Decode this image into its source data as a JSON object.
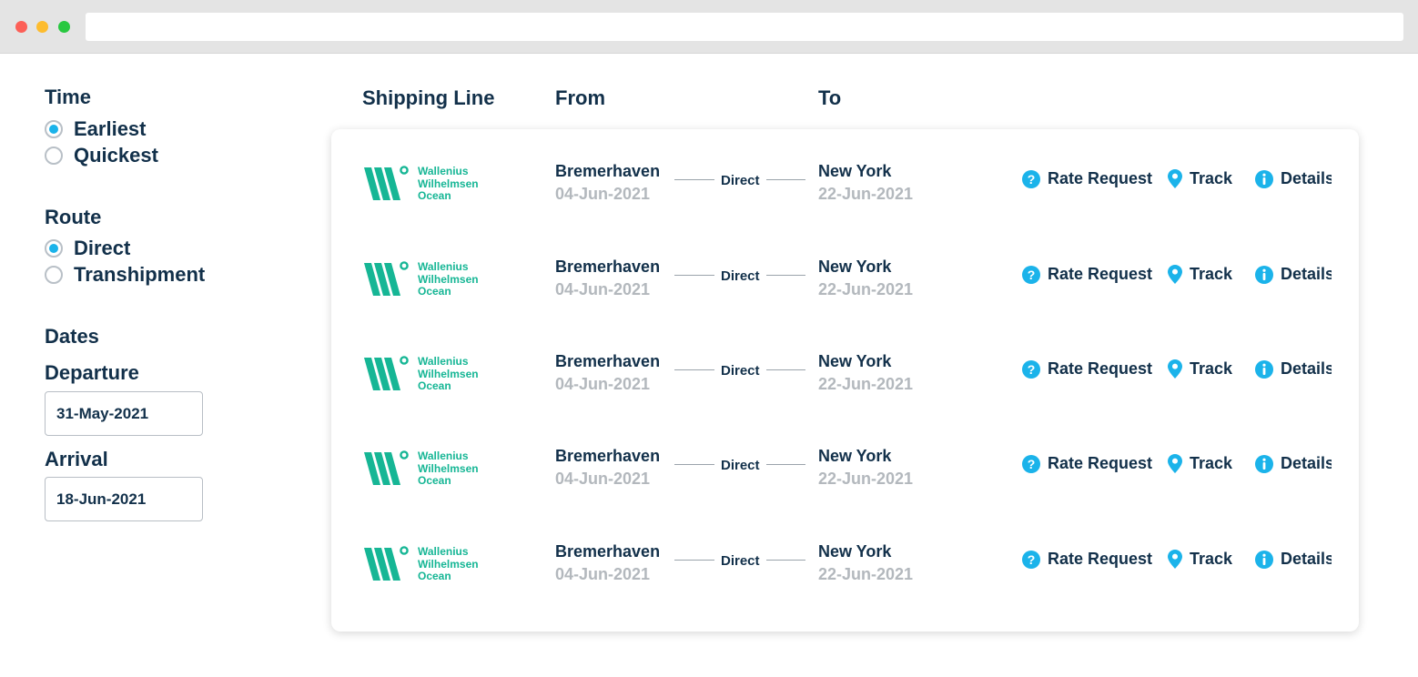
{
  "filters": {
    "time": {
      "title": "Time",
      "options": [
        {
          "label": "Earliest",
          "selected": true
        },
        {
          "label": "Quickest",
          "selected": false
        }
      ]
    },
    "route": {
      "title": "Route",
      "options": [
        {
          "label": "Direct",
          "selected": true
        },
        {
          "label": "Transhipment",
          "selected": false
        }
      ]
    },
    "dates": {
      "title": "Dates",
      "departure_label": "Departure",
      "departure_value": "31-May-2021",
      "arrival_label": "Arrival",
      "arrival_value": "18-Jun-2021"
    }
  },
  "table": {
    "headers": {
      "shipping_line": "Shipping Line",
      "from": "From",
      "to": "To"
    },
    "rows": [
      {
        "carrier": [
          "Wallenius",
          "Wilhelmsen",
          "Ocean"
        ],
        "from_city": "Bremerhaven",
        "from_date": "04-Jun-2021",
        "route": "Direct",
        "to_city": "New York",
        "to_date": "22-Jun-2021",
        "rate_label": "Rate Request",
        "track_label": "Track",
        "details_label": "Details"
      },
      {
        "carrier": [
          "Wallenius",
          "Wilhelmsen",
          "Ocean"
        ],
        "from_city": "Bremerhaven",
        "from_date": "04-Jun-2021",
        "route": "Direct",
        "to_city": "New York",
        "to_date": "22-Jun-2021",
        "rate_label": "Rate Request",
        "track_label": "Track",
        "details_label": "Details"
      },
      {
        "carrier": [
          "Wallenius",
          "Wilhelmsen",
          "Ocean"
        ],
        "from_city": "Bremerhaven",
        "from_date": "04-Jun-2021",
        "route": "Direct",
        "to_city": "New York",
        "to_date": "22-Jun-2021",
        "rate_label": "Rate Request",
        "track_label": "Track",
        "details_label": "Details"
      },
      {
        "carrier": [
          "Wallenius",
          "Wilhelmsen",
          "Ocean"
        ],
        "from_city": "Bremerhaven",
        "from_date": "04-Jun-2021",
        "route": "Direct",
        "to_city": "New York",
        "to_date": "22-Jun-2021",
        "rate_label": "Rate Request",
        "track_label": "Track",
        "details_label": "Details"
      },
      {
        "carrier": [
          "Wallenius",
          "Wilhelmsen",
          "Ocean"
        ],
        "from_city": "Bremerhaven",
        "from_date": "04-Jun-2021",
        "route": "Direct",
        "to_city": "New York",
        "to_date": "22-Jun-2021",
        "rate_label": "Rate Request",
        "track_label": "Track",
        "details_label": "Details"
      }
    ]
  },
  "icons": {
    "rate": "question-circle-icon",
    "track": "map-pin-icon",
    "details": "info-circle-icon"
  },
  "colors": {
    "accent": "#1bb3ea",
    "brand": "#16b695",
    "text": "#12304a",
    "muted": "#b3b8bd"
  }
}
